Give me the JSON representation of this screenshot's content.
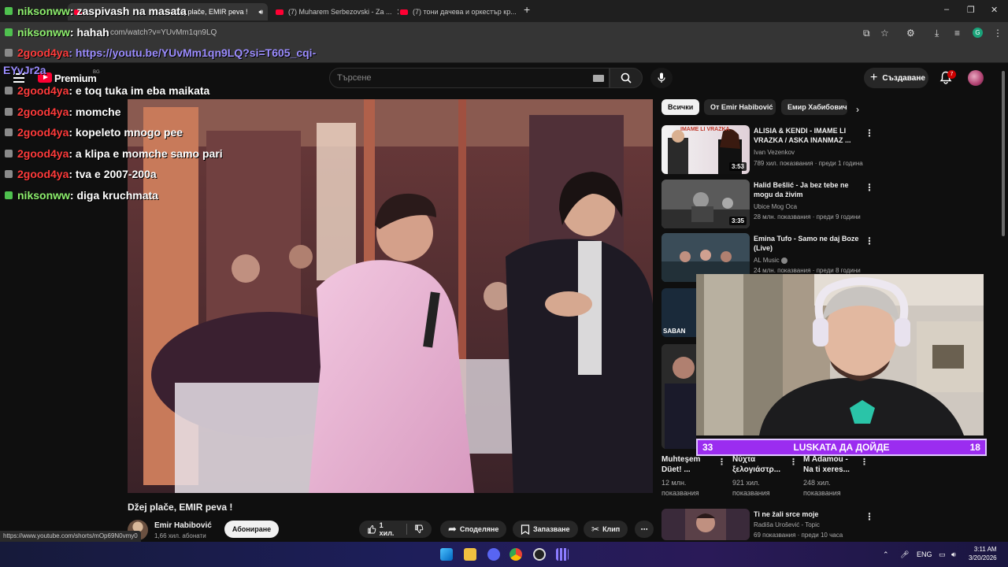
{
  "browser": {
    "tabs": [
      {
        "label": "Džej plače, EMIR peva !",
        "active": true
      },
      {
        "label": "(7) Muharem Serbezovski - Za ...",
        "active": false
      },
      {
        "label": "(7) тони дачева и оркестър кр...",
        "active": false
      }
    ],
    "address": "com/watch?v=YUvMm1qn9LQ",
    "profile_initial": "G",
    "window_controls": [
      "–",
      "❐",
      "✕"
    ]
  },
  "youtube": {
    "logo_text": "Premium",
    "region": "BG",
    "search_placeholder": "Търсене",
    "create_label": "Създаване",
    "notification_count": "7"
  },
  "video": {
    "title": "Džej plače, EMIR peva !",
    "channel": "Emir Habibović",
    "subscribers": "1,66 хил. абонати",
    "subscribe_label": "Абониране",
    "likes": "1 хил.",
    "share_label": "Споделяне",
    "save_label": "Запазване",
    "clip_label": "Клип"
  },
  "hover_url": "https://www.youtube.com/shorts/mOp69N0vmy0",
  "chips": [
    "Всички",
    "От Emir Habibović",
    "Емир Хабибович"
  ],
  "recommendations": [
    {
      "title": "ALISIA & KENDI - IMAME LI VRAZKA / ASKA INANMAZ ...",
      "channel": "Ivan Vezenkov",
      "meta": "789 хил. показвания · преди 1 година",
      "duration": "3:53",
      "thumb_text": "IMAME LI VRAZKA"
    },
    {
      "title": "Halid Bešlić - Ja bez tebe ne mogu da živim",
      "channel": "Ubice Mog Oca",
      "meta": "28 млн. показвания · преди 9 години",
      "duration": "3:35"
    },
    {
      "title": "Emina Tufo - Samo ne daj Boze (Live)",
      "channel": "AL Music",
      "meta": "24 млн. показвания · преди 8 години"
    }
  ],
  "shorts": [
    {
      "title": "Muhteşem Düet! ...",
      "views": "12 млн.",
      "label": "показвания"
    },
    {
      "title": "Νύχτα ξελογιάστρ...",
      "views": "921 хил.",
      "label": "показвания"
    },
    {
      "title": "M Adamou - Na ti xeres...",
      "views": "248 хил.",
      "label": "показвания"
    }
  ],
  "shorts_label": "SABAN",
  "last_recommendation": {
    "title": "Ti ne žali srce moje",
    "channel": "Radiša Urošević - Topic",
    "meta": "69 показвания · преди 10 часа"
  },
  "stream_banner": {
    "left": "33",
    "text": "LUSKATA ДА ДОЙДЕ",
    "right": "18"
  },
  "chat": [
    {
      "user": "niksonww",
      "color": "#8ef06e",
      "badge": "green",
      "text": ": zaspivash na masata"
    },
    {
      "user": "niksonww",
      "color": "#8ef06e",
      "badge": "green",
      "text": ": hahah"
    },
    {
      "user": "2good4ya",
      "color": "#ff3b3b",
      "badge": "gray",
      "text": ": https://youtu.be/YUvMm1qn9LQ?si=T605_cqi-",
      "link": true
    },
    {
      "user": "",
      "color": "#9b8cff",
      "badge": "none",
      "text": "EYvJr2a",
      "link": true
    },
    {
      "user": "2good4ya",
      "color": "#ff3b3b",
      "badge": "gray",
      "text": ": e toq tuka im eba maikata"
    },
    {
      "user": "2good4ya",
      "color": "#ff3b3b",
      "badge": "gray",
      "text": ": momche"
    },
    {
      "user": "2good4ya",
      "color": "#ff3b3b",
      "badge": "gray",
      "text": ": kopeleto mnogo pee"
    },
    {
      "user": "2good4ya",
      "color": "#ff3b3b",
      "badge": "gray",
      "text": ": a klipa e momche samo pari"
    },
    {
      "user": "2good4ya",
      "color": "#ff3b3b",
      "badge": "gray",
      "text": ": tva e 2007-200a"
    },
    {
      "user": "niksonww",
      "color": "#8ef06e",
      "badge": "green",
      "text": ": diga kruchmata"
    }
  ],
  "taskbar": {
    "lang": "ENG",
    "time": "3:11 AM",
    "date": "3/20/2026"
  },
  "colors": {
    "accent_red": "#ff0033",
    "banner": "#9b2cf0",
    "niksonww": "#8ef06e",
    "2good4ya": "#ff3b3b"
  }
}
